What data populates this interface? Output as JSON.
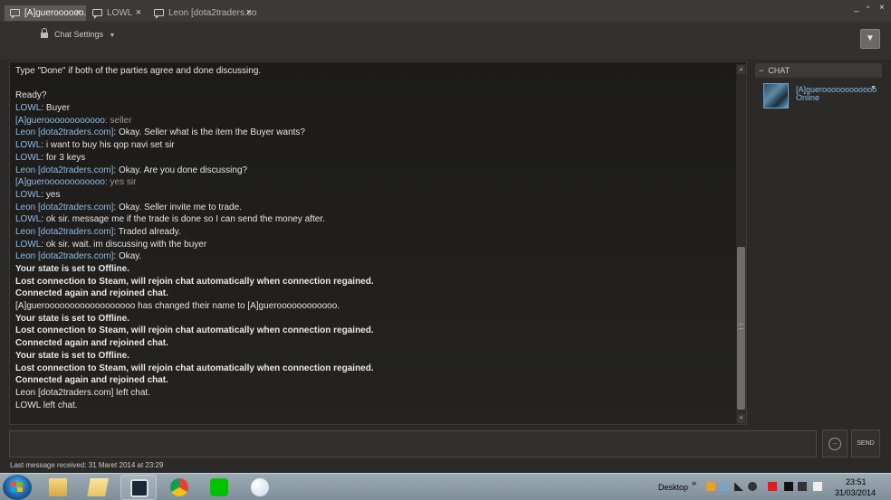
{
  "tabs": [
    {
      "label": "[A]gueroooooo..."
    },
    {
      "label": "LOWL"
    },
    {
      "label": "Leon [dota2traders.com]"
    }
  ],
  "header": {
    "chat_settings_label": "Chat Settings"
  },
  "chat_log": [
    {
      "type": "plain",
      "text": "Type \"Done\" if both of the parties agree and done discussing."
    },
    {
      "type": "blank",
      "text": ""
    },
    {
      "type": "plain",
      "text": "Ready?"
    },
    {
      "type": "msg",
      "name": "LOWL",
      "text": ": Buyer"
    },
    {
      "type": "msg",
      "name": "[A]gueroooooooooooo",
      "text": ": seller",
      "dim": true
    },
    {
      "type": "msg",
      "name": "Leon [dota2traders.com]",
      "text": ": Okay. Seller what is the item the Buyer wants?"
    },
    {
      "type": "msg",
      "name": "LOWL",
      "text": ": i want to buy his qop navi set sir"
    },
    {
      "type": "msg",
      "name": "LOWL",
      "text": ": for 3 keys"
    },
    {
      "type": "msg",
      "name": "Leon [dota2traders.com]",
      "text": ": Okay. Are you done discussing?"
    },
    {
      "type": "msg",
      "name": "[A]gueroooooooooooo",
      "text": ": yes sir",
      "dim": true
    },
    {
      "type": "msg",
      "name": "LOWL",
      "text": ": yes"
    },
    {
      "type": "msg",
      "name": "Leon [dota2traders.com]",
      "text": ": Okay. Seller invite me to trade."
    },
    {
      "type": "msg",
      "name": "LOWL",
      "text": ": ok sir. message me if the trade is done so I can send the money after."
    },
    {
      "type": "msg",
      "name": "Leon [dota2traders.com]",
      "text": ": Traded already."
    },
    {
      "type": "msg",
      "name": "LOWL",
      "text": ": ok sir. wait. im discussing with the buyer"
    },
    {
      "type": "msg",
      "name": "Leon [dota2traders.com]",
      "text": ": Okay."
    },
    {
      "type": "sys",
      "text": "Your state is set to Offline."
    },
    {
      "type": "sys",
      "text": "Lost connection to Steam, will rejoin chat automatically when connection regained."
    },
    {
      "type": "sys",
      "text": "Connected again and rejoined chat."
    },
    {
      "type": "plain",
      "text": "[A]gueroooooooooooooooooo has changed their name to [A]gueroooooooooooo."
    },
    {
      "type": "sys",
      "text": "Your state is set to Offline."
    },
    {
      "type": "sys",
      "text": "Lost connection to Steam, will rejoin chat automatically when connection regained."
    },
    {
      "type": "sys",
      "text": "Connected again and rejoined chat."
    },
    {
      "type": "sys",
      "text": "Your state is set to Offline."
    },
    {
      "type": "sys",
      "text": "Lost connection to Steam, will rejoin chat automatically when connection regained."
    },
    {
      "type": "sys",
      "text": "Connected again and rejoined chat."
    },
    {
      "type": "plain",
      "text": "Leon [dota2traders.com] left chat."
    },
    {
      "type": "plain",
      "text": "LOWL left chat."
    }
  ],
  "friends_panel": {
    "header": "CHAT",
    "members": [
      {
        "name": "[A]gueroooooooooooo",
        "status": "Online"
      }
    ]
  },
  "input": {
    "value": "",
    "send_label": "SEND"
  },
  "footer": {
    "last_message": "Last message received: 31 Maret 2014 at 23:29"
  },
  "taskbar": {
    "desktop_label": "Desktop",
    "pinned": [
      "file-explorer",
      "folder",
      "steam",
      "chrome",
      "line",
      "paint"
    ],
    "time": "23:51",
    "date": "31/03/2014"
  },
  "colors": {
    "username": "#8dbce6",
    "background": "#2b2a28",
    "log_background": "#1c1b1a"
  }
}
